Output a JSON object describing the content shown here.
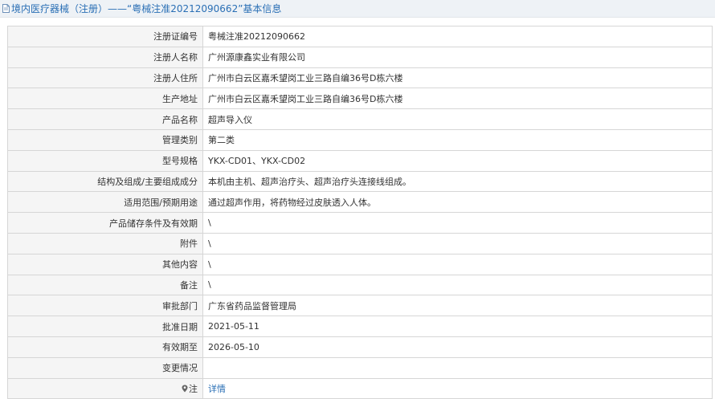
{
  "header": {
    "title": "境内医疗器械（注册）——“粤械注准20212090662”基本信息"
  },
  "rows": [
    {
      "label": "注册证编号",
      "value": "粤械注准20212090662"
    },
    {
      "label": "注册人名称",
      "value": "广州源康鑫实业有限公司"
    },
    {
      "label": "注册人住所",
      "value": "广州市白云区嘉禾望岗工业三路自编36号D栋六楼"
    },
    {
      "label": "生产地址",
      "value": "广州市白云区嘉禾望岗工业三路自编36号D栋六楼"
    },
    {
      "label": "产品名称",
      "value": "超声导入仪"
    },
    {
      "label": "管理类别",
      "value": "第二类"
    },
    {
      "label": "型号规格",
      "value": "YKX-CD01、YKX-CD02"
    },
    {
      "label": "结构及组成/主要组成成分",
      "value": "本机由主机、超声治疗头、超声治疗头连接线组成。"
    },
    {
      "label": "适用范围/预期用途",
      "value": "通过超声作用，将药物经过皮肤透入人体。"
    },
    {
      "label": "产品储存条件及有效期",
      "value": "\\"
    },
    {
      "label": "附件",
      "value": "\\"
    },
    {
      "label": "其他内容",
      "value": "\\"
    },
    {
      "label": "备注",
      "value": "\\"
    },
    {
      "label": "审批部门",
      "value": "广东省药品监督管理局"
    },
    {
      "label": "批准日期",
      "value": "2021-05-11"
    },
    {
      "label": "有效期至",
      "value": "2026-05-10"
    },
    {
      "label": "变更情况",
      "value": ""
    }
  ],
  "note_row": {
    "label": "注",
    "link_text": "详情",
    "icon": "pin-icon"
  },
  "colors": {
    "header_bg": "#eef2f6",
    "link": "#2a6fb5",
    "label_bg": "#f5f5f5",
    "border": "#d6d6d6"
  }
}
